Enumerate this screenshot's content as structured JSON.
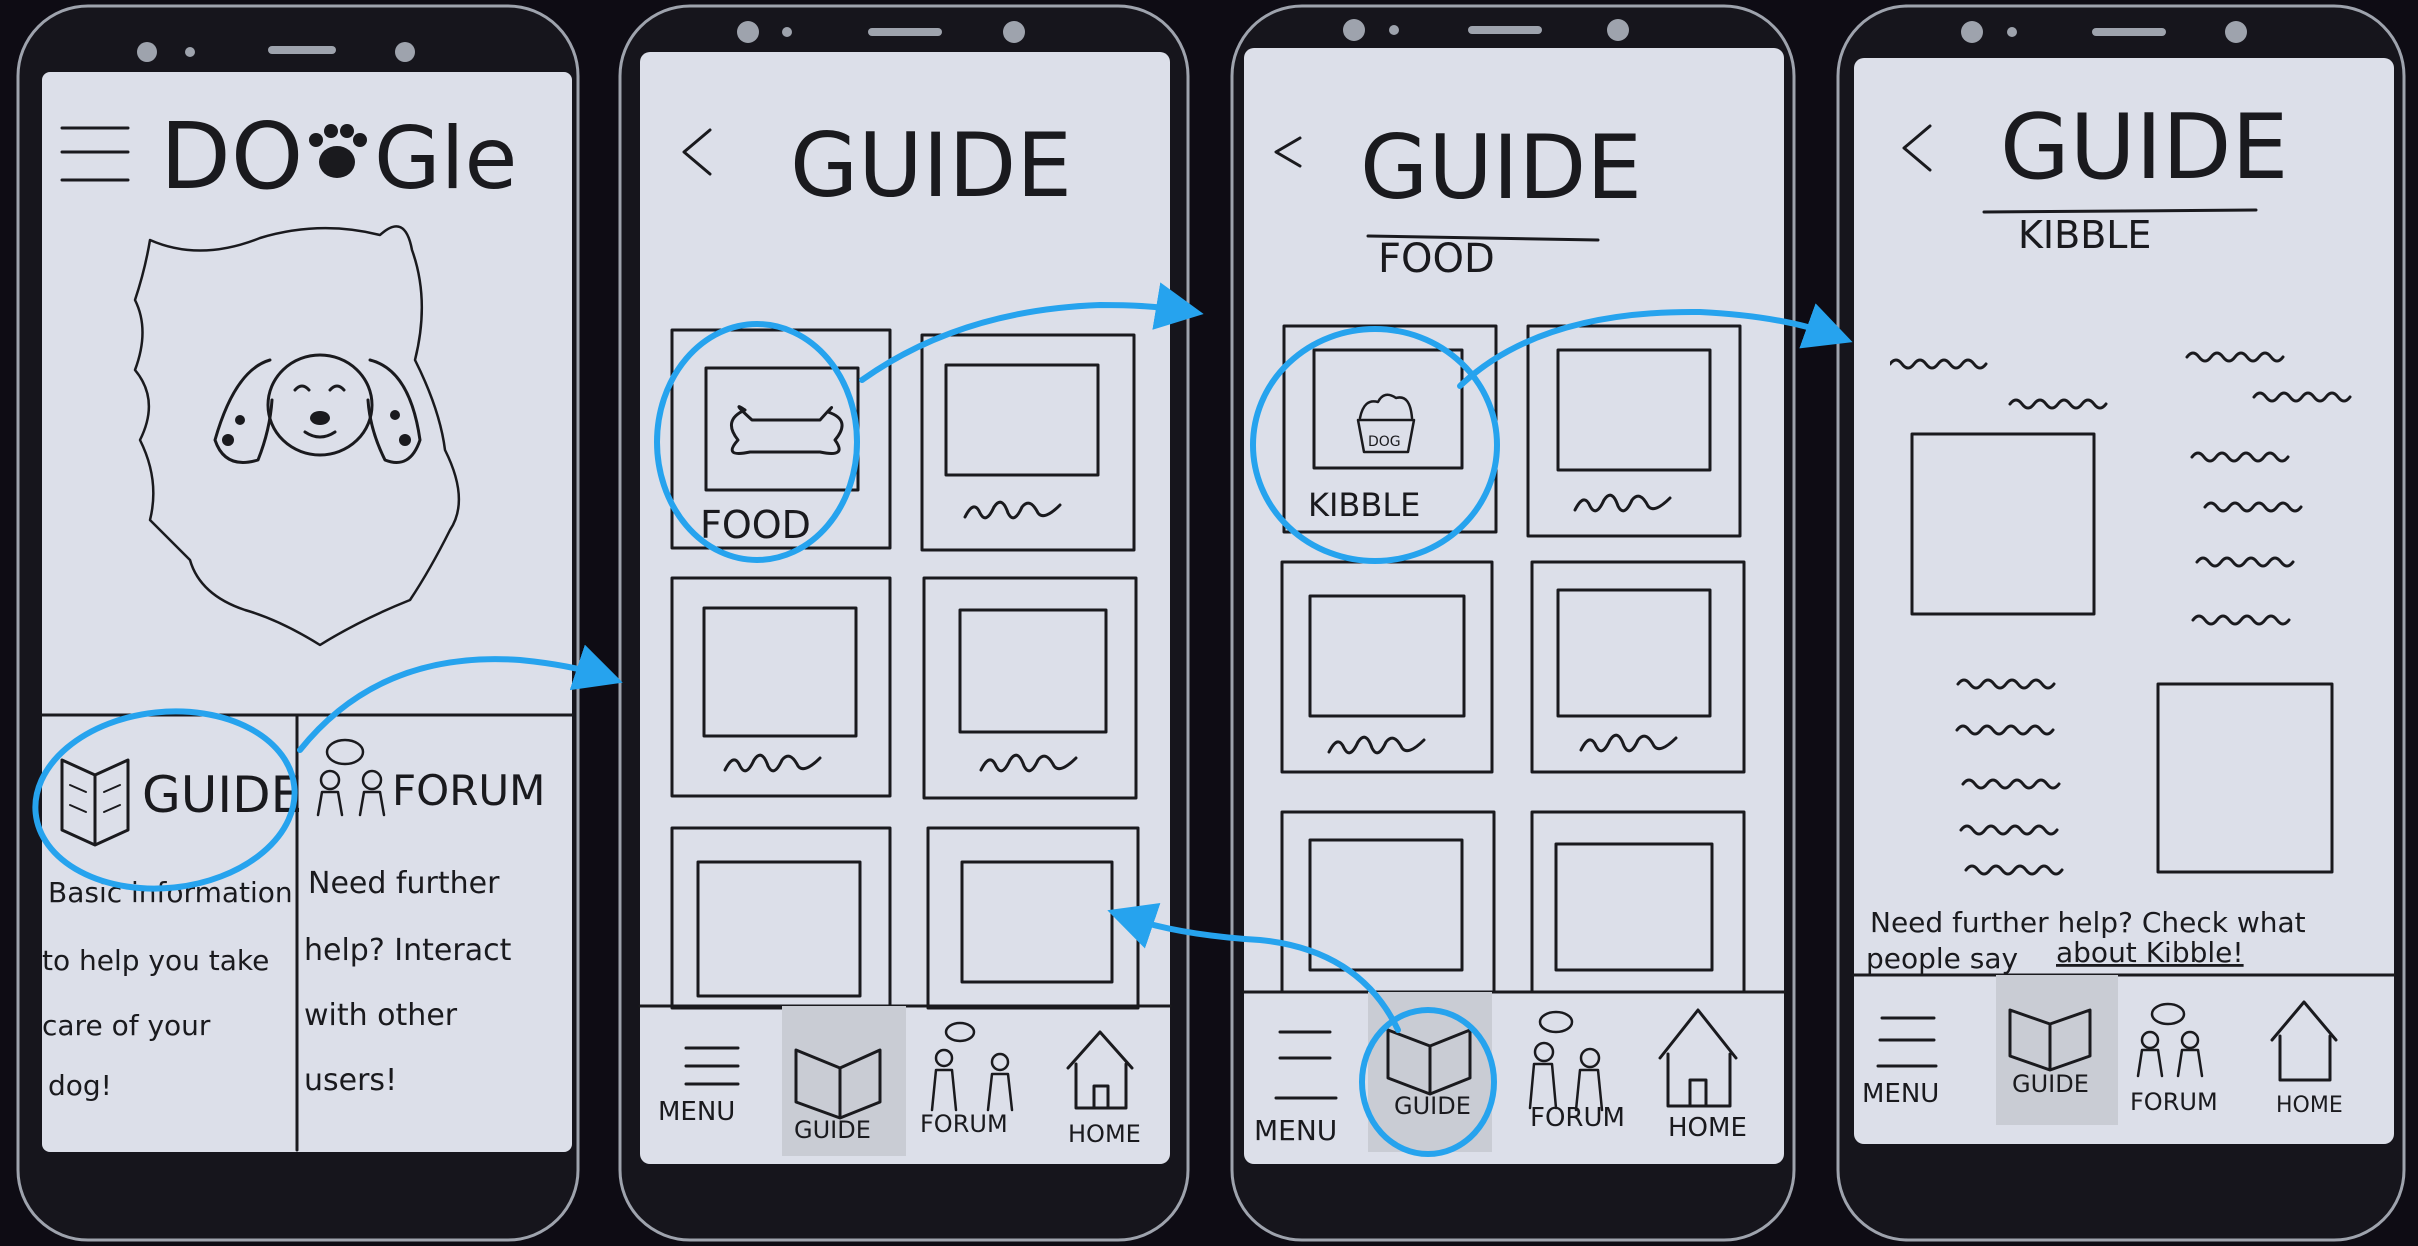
{
  "colors": {
    "paper": "#dcdfe9",
    "ink": "#1a1a1e",
    "highlight": "#26a3ee",
    "phone_body": "#16151c"
  },
  "screens": {
    "home": {
      "menu_icon": "hamburger-icon",
      "app_title_left": "DO",
      "app_title_right": "Gle",
      "logo_icon": "paw-icon",
      "hero_icon": "dog-face-icon",
      "guide_label": "GUIDE",
      "guide_icon": "open-book-icon",
      "forum_label": "FORUM",
      "forum_icon": "people-chat-icon",
      "guide_desc": [
        "Basic information",
        "to help you take",
        "care of your",
        "dog!"
      ],
      "forum_desc": [
        "Need further",
        "help? Interact",
        "with other",
        "users!"
      ]
    },
    "guide": {
      "back_icon": "back-chevron-icon",
      "title": "GUIDE",
      "tiles": [
        {
          "label": "FOOD",
          "icon": "bone-icon"
        },
        {
          "label": "",
          "icon": "image-placeholder-icon"
        },
        {
          "label": "",
          "icon": "image-placeholder-icon"
        },
        {
          "label": "",
          "icon": "image-placeholder-icon"
        },
        {
          "label": "",
          "icon": "image-placeholder-icon"
        },
        {
          "label": "",
          "icon": "image-placeholder-icon"
        }
      ]
    },
    "food": {
      "back_icon": "back-chevron-icon",
      "title": "GUIDE",
      "subtitle": "FOOD",
      "tiles": [
        {
          "label": "KIBBLE",
          "icon": "dog-food-bowl-icon",
          "bowl_text": "DOG"
        },
        {
          "label": "",
          "icon": "image-placeholder-icon"
        },
        {
          "label": "",
          "icon": "image-placeholder-icon"
        },
        {
          "label": "",
          "icon": "image-placeholder-icon"
        },
        {
          "label": "",
          "icon": "image-placeholder-icon"
        },
        {
          "label": "",
          "icon": "image-placeholder-icon"
        }
      ]
    },
    "kibble": {
      "back_icon": "back-chevron-icon",
      "title": "GUIDE",
      "subtitle": "KIBBLE",
      "footer_line1": "Need further help? Check what",
      "footer_line2_start": "people say",
      "footer_link": "about Kibble!"
    }
  },
  "nav": {
    "items": [
      {
        "label": "MENU",
        "icon": "hamburger-icon"
      },
      {
        "label": "GUIDE",
        "icon": "open-book-icon"
      },
      {
        "label": "FORUM",
        "icon": "people-chat-icon"
      },
      {
        "label": "HOME",
        "icon": "house-icon"
      }
    ]
  }
}
